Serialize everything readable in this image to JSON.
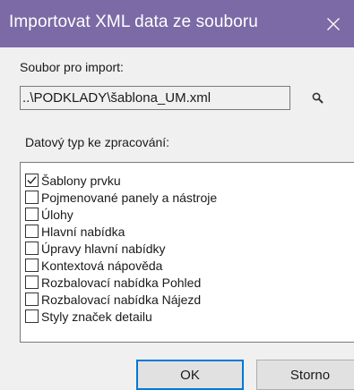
{
  "window": {
    "title": "Importovat XML data ze souboru",
    "close_icon": "close-icon",
    "accent": "#7b6aa6"
  },
  "import": {
    "label": "Soubor pro import:",
    "path": "..\\PODKLADY\\šablona_UM.xml",
    "browse_icon": "search-icon"
  },
  "data_types": {
    "label": "Datový typ ke zpracování:",
    "items": [
      {
        "label": "Šablony prvku",
        "checked": true
      },
      {
        "label": "Pojmenované panely a nástroje",
        "checked": false
      },
      {
        "label": "Úlohy",
        "checked": false
      },
      {
        "label": "Hlavní nabídka",
        "checked": false
      },
      {
        "label": "Úpravy hlavní nabídky",
        "checked": false
      },
      {
        "label": "Kontextová nápověda",
        "checked": false
      },
      {
        "label": "Rozbalovací nabídka Pohled",
        "checked": false
      },
      {
        "label": "Rozbalovací nabídka Nájezd",
        "checked": false
      },
      {
        "label": "Styly značek detailu",
        "checked": false
      }
    ]
  },
  "buttons": {
    "ok": "OK",
    "cancel": "Storno"
  }
}
